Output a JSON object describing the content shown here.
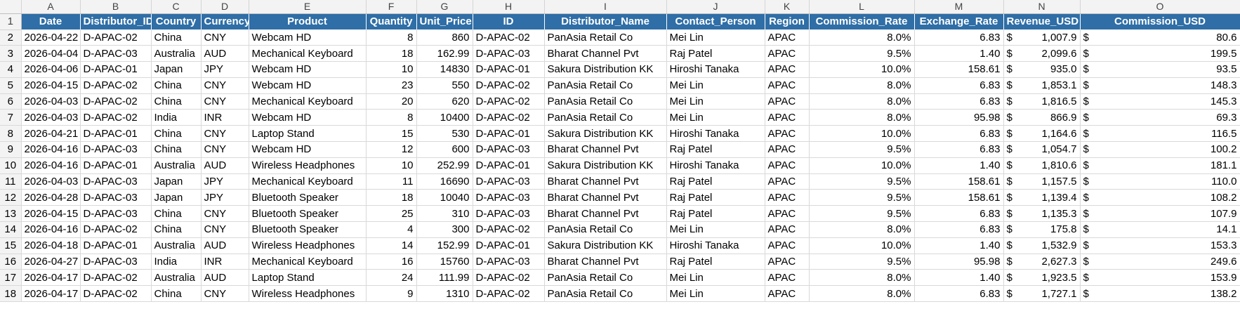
{
  "column_letters": [
    "A",
    "B",
    "C",
    "D",
    "E",
    "F",
    "G",
    "H",
    "I",
    "J",
    "K",
    "L",
    "M",
    "N",
    "O"
  ],
  "headers": [
    "Date",
    "Distributor_ID",
    "Country",
    "Currency",
    "Product",
    "Quantity",
    "Unit_Price",
    "ID",
    "Distributor_Name",
    "Contact_Person",
    "Region",
    "Commission_Rate",
    "Exchange_Rate",
    "Revenue_USD",
    "Commission_USD"
  ],
  "row_numbers": [
    "1",
    "2",
    "3",
    "4",
    "5",
    "6",
    "7",
    "8",
    "9",
    "10",
    "11",
    "12",
    "13",
    "14",
    "15",
    "16",
    "17",
    "18"
  ],
  "currency_symbol": "$",
  "rows": [
    [
      "2026-04-22",
      "D-APAC-02",
      "China",
      "CNY",
      "Webcam HD",
      "8",
      "860",
      "D-APAC-02",
      "PanAsia Retail Co",
      "Mei Lin",
      "APAC",
      "8.0%",
      "6.83",
      "1,007.9",
      "80.6"
    ],
    [
      "2026-04-04",
      "D-APAC-03",
      "Australia",
      "AUD",
      "Mechanical Keyboard",
      "18",
      "162.99",
      "D-APAC-03",
      "Bharat Channel Pvt",
      "Raj Patel",
      "APAC",
      "9.5%",
      "1.40",
      "2,099.6",
      "199.5"
    ],
    [
      "2026-04-06",
      "D-APAC-01",
      "Japan",
      "JPY",
      "Webcam HD",
      "10",
      "14830",
      "D-APAC-01",
      "Sakura Distribution KK",
      "Hiroshi Tanaka",
      "APAC",
      "10.0%",
      "158.61",
      "935.0",
      "93.5"
    ],
    [
      "2026-04-15",
      "D-APAC-02",
      "China",
      "CNY",
      "Webcam HD",
      "23",
      "550",
      "D-APAC-02",
      "PanAsia Retail Co",
      "Mei Lin",
      "APAC",
      "8.0%",
      "6.83",
      "1,853.1",
      "148.3"
    ],
    [
      "2026-04-03",
      "D-APAC-02",
      "China",
      "CNY",
      "Mechanical Keyboard",
      "20",
      "620",
      "D-APAC-02",
      "PanAsia Retail Co",
      "Mei Lin",
      "APAC",
      "8.0%",
      "6.83",
      "1,816.5",
      "145.3"
    ],
    [
      "2026-04-03",
      "D-APAC-02",
      "India",
      "INR",
      "Webcam HD",
      "8",
      "10400",
      "D-APAC-02",
      "PanAsia Retail Co",
      "Mei Lin",
      "APAC",
      "8.0%",
      "95.98",
      "866.9",
      "69.3"
    ],
    [
      "2026-04-21",
      "D-APAC-01",
      "China",
      "CNY",
      "Laptop Stand",
      "15",
      "530",
      "D-APAC-01",
      "Sakura Distribution KK",
      "Hiroshi Tanaka",
      "APAC",
      "10.0%",
      "6.83",
      "1,164.6",
      "116.5"
    ],
    [
      "2026-04-16",
      "D-APAC-03",
      "China",
      "CNY",
      "Webcam HD",
      "12",
      "600",
      "D-APAC-03",
      "Bharat Channel Pvt",
      "Raj Patel",
      "APAC",
      "9.5%",
      "6.83",
      "1,054.7",
      "100.2"
    ],
    [
      "2026-04-16",
      "D-APAC-01",
      "Australia",
      "AUD",
      "Wireless Headphones",
      "10",
      "252.99",
      "D-APAC-01",
      "Sakura Distribution KK",
      "Hiroshi Tanaka",
      "APAC",
      "10.0%",
      "1.40",
      "1,810.6",
      "181.1"
    ],
    [
      "2026-04-03",
      "D-APAC-03",
      "Japan",
      "JPY",
      "Mechanical Keyboard",
      "11",
      "16690",
      "D-APAC-03",
      "Bharat Channel Pvt",
      "Raj Patel",
      "APAC",
      "9.5%",
      "158.61",
      "1,157.5",
      "110.0"
    ],
    [
      "2026-04-28",
      "D-APAC-03",
      "Japan",
      "JPY",
      "Bluetooth Speaker",
      "18",
      "10040",
      "D-APAC-03",
      "Bharat Channel Pvt",
      "Raj Patel",
      "APAC",
      "9.5%",
      "158.61",
      "1,139.4",
      "108.2"
    ],
    [
      "2026-04-15",
      "D-APAC-03",
      "China",
      "CNY",
      "Bluetooth Speaker",
      "25",
      "310",
      "D-APAC-03",
      "Bharat Channel Pvt",
      "Raj Patel",
      "APAC",
      "9.5%",
      "6.83",
      "1,135.3",
      "107.9"
    ],
    [
      "2026-04-16",
      "D-APAC-02",
      "China",
      "CNY",
      "Bluetooth Speaker",
      "4",
      "300",
      "D-APAC-02",
      "PanAsia Retail Co",
      "Mei Lin",
      "APAC",
      "8.0%",
      "6.83",
      "175.8",
      "14.1"
    ],
    [
      "2026-04-18",
      "D-APAC-01",
      "Australia",
      "AUD",
      "Wireless Headphones",
      "14",
      "152.99",
      "D-APAC-01",
      "Sakura Distribution KK",
      "Hiroshi Tanaka",
      "APAC",
      "10.0%",
      "1.40",
      "1,532.9",
      "153.3"
    ],
    [
      "2026-04-27",
      "D-APAC-03",
      "India",
      "INR",
      "Mechanical Keyboard",
      "16",
      "15760",
      "D-APAC-03",
      "Bharat Channel Pvt",
      "Raj Patel",
      "APAC",
      "9.5%",
      "95.98",
      "2,627.3",
      "249.6"
    ],
    [
      "2026-04-17",
      "D-APAC-02",
      "Australia",
      "AUD",
      "Laptop Stand",
      "24",
      "111.99",
      "D-APAC-02",
      "PanAsia Retail Co",
      "Mei Lin",
      "APAC",
      "8.0%",
      "1.40",
      "1,923.5",
      "153.9"
    ],
    [
      "2026-04-17",
      "D-APAC-02",
      "China",
      "CNY",
      "Wireless Headphones",
      "9",
      "1310",
      "D-APAC-02",
      "PanAsia Retail Co",
      "Mei Lin",
      "APAC",
      "8.0%",
      "6.83",
      "1,727.1",
      "138.2"
    ]
  ]
}
